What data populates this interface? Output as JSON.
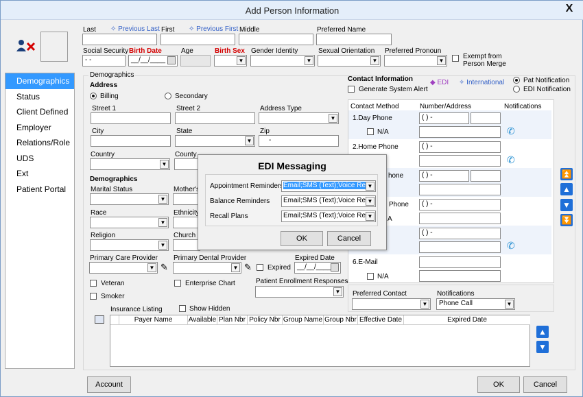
{
  "window": {
    "title": "Add Person Information",
    "close": "X"
  },
  "header": {
    "last_label": "Last",
    "prev_last": "Previous Last",
    "first_label": "First",
    "prev_first": "Previous First",
    "middle_label": "Middle",
    "preferred_name_label": "Preferred Name",
    "ssn_label": "Social Security",
    "ssn_value": "- -",
    "birth_date_label": "Birth Date",
    "birth_date_value": "__/__/____",
    "age_label": "Age",
    "birth_sex_label": "Birth Sex",
    "gender_identity_label": "Gender Identity",
    "sexual_orientation_label": "Sexual Orientation",
    "preferred_pronoun_label": "Preferred Pronoun",
    "exempt_label_1": "Exempt from",
    "exempt_label_2": "Person Merge"
  },
  "sidebar": {
    "items": [
      "Demographics",
      "Status",
      "Client Defined",
      "Employer",
      "Relations/Role",
      "UDS",
      "Ext",
      "Patient Portal"
    ]
  },
  "demographics": {
    "group_label": "Demographics",
    "address_heading": "Address",
    "billing": "Billing",
    "secondary": "Secondary",
    "street1": "Street 1",
    "street2": "Street 2",
    "address_type": "Address Type",
    "city": "City",
    "state": "State",
    "zip": "Zip",
    "zip_value": "-",
    "country": "Country",
    "county": "County",
    "demographics_heading": "Demographics",
    "marital_status": "Marital Status",
    "mothers": "Mother's",
    "race": "Race",
    "ethnicity": "Ethnicity",
    "religion": "Religion",
    "church": "Church",
    "primary_care_provider": "Primary Care Provider",
    "primary_dental_provider": "Primary Dental Provider",
    "expired": "Expired",
    "expired_date": "Expired Date",
    "expired_date_value": "__/__/____",
    "veteran": "Veteran",
    "enterprise_chart": "Enterprise Chart",
    "patient_enrollment_responses": "Patient Enrollment Responses",
    "smoker": "Smoker",
    "insurance_listing": "Insurance Listing",
    "show_hidden": "Show Hidden"
  },
  "contact": {
    "heading": "Contact Information",
    "generate_alert": "Generate System Alert",
    "edi": "EDI",
    "international": "International",
    "pat_notification": "Pat Notification",
    "edi_notification": "EDI Notification",
    "col_method": "Contact Method",
    "col_number": "Number/Address",
    "col_notifications": "Notifications",
    "rows": [
      {
        "label": "1.Day Phone",
        "value": "(  )   -",
        "na": "N/A"
      },
      {
        "label": "2.Home Phone",
        "value": "(  )   -",
        "na": "N/A"
      },
      {
        "label": "hone",
        "value": "(  )   -",
        "na": ""
      },
      {
        "label": "Phone",
        "value": "(  )   -",
        "na": "A"
      },
      {
        "label": "",
        "value": "(  )   -",
        "na": ""
      },
      {
        "label": "6.E-Mail",
        "value": "",
        "na": "N/A"
      }
    ],
    "preferred_contact": "Preferred Contact",
    "notifications_label": "Notifications",
    "notifications_value": "Phone Call"
  },
  "insurance_grid": {
    "columns": [
      "Payer Name",
      "Available",
      "Plan Nbr",
      "Policy Nbr",
      "Group Name",
      "Group Nbr",
      "Effective Date",
      "Expired Date"
    ]
  },
  "edi_dialog": {
    "title": "EDI Messaging",
    "rows": [
      {
        "label": "Appointment Reminders",
        "value": "Email;SMS (Text);Voice Re"
      },
      {
        "label": "Balance Reminders",
        "value": "Email;SMS (Text);Voice Ren"
      },
      {
        "label": "Recall Plans",
        "value": "Email;SMS (Text);Voice Ren"
      }
    ],
    "ok": "OK",
    "cancel": "Cancel"
  },
  "footer": {
    "account": "Account",
    "ok": "OK",
    "cancel": "Cancel"
  }
}
